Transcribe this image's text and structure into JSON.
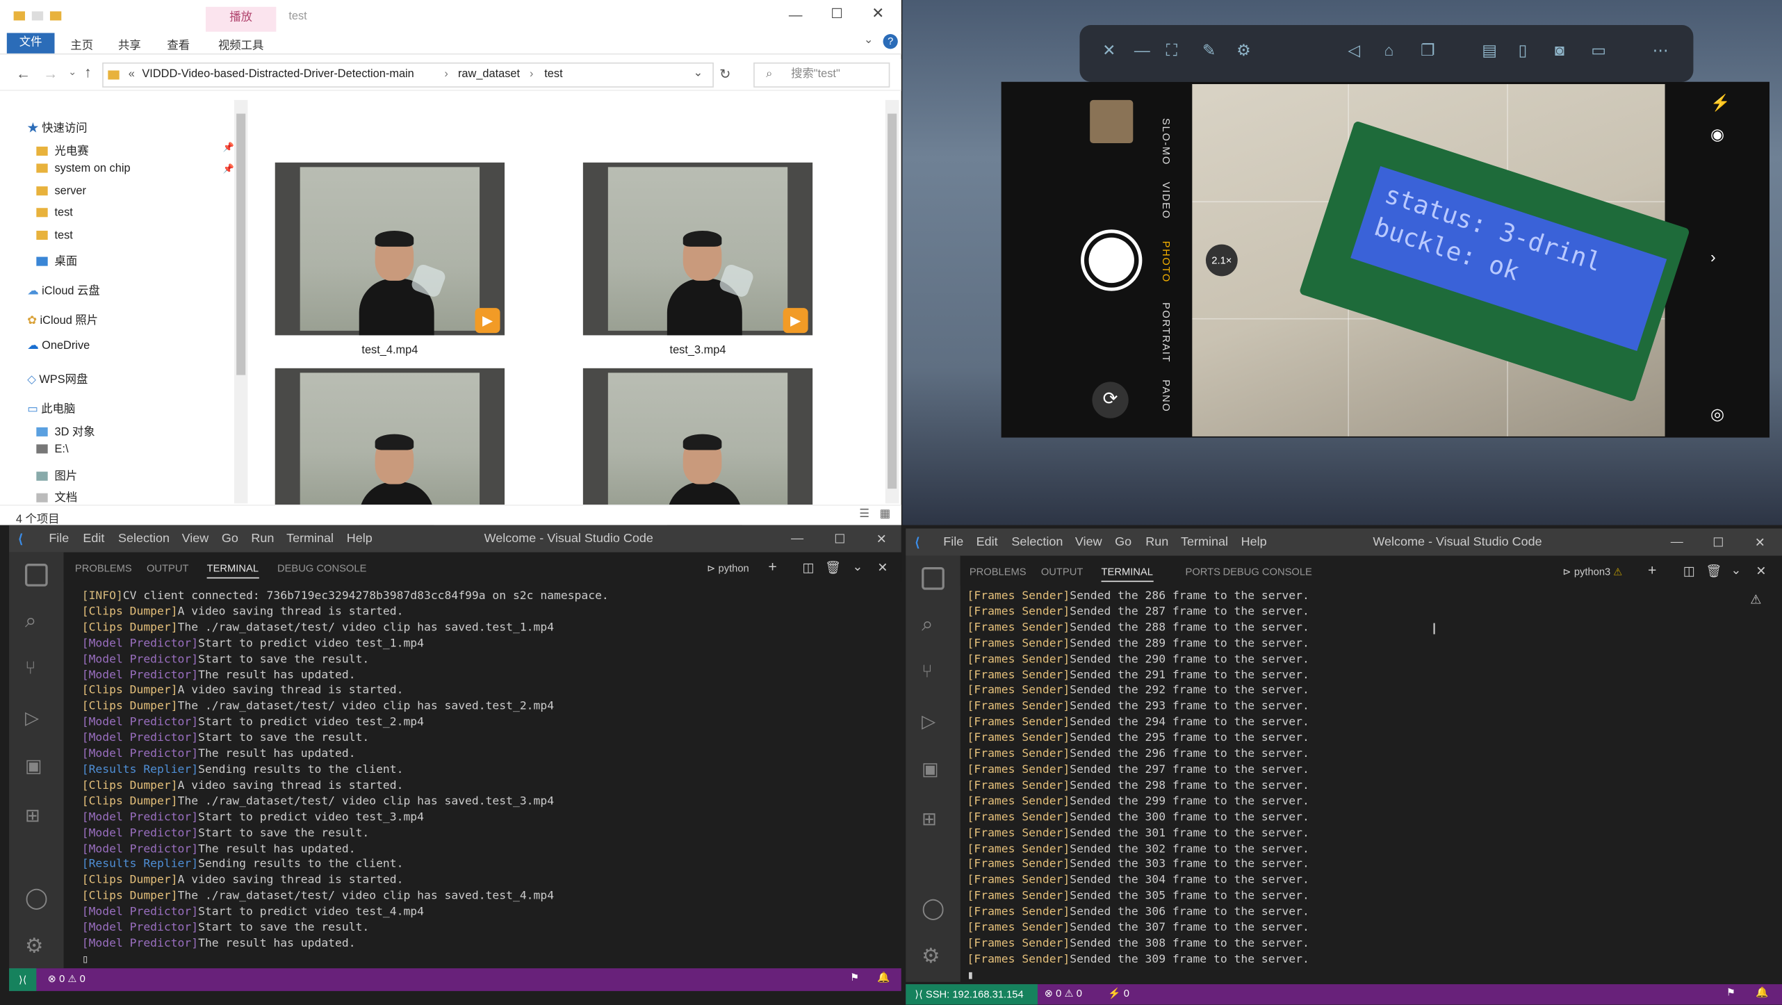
{
  "explorer": {
    "window_title": "test",
    "ribbon_context_tab": "播放",
    "ribbon_tabs": [
      "文件",
      "主页",
      "共享",
      "查看"
    ],
    "video_tools": "视频工具",
    "breadcrumb": [
      "«",
      "VIDDD-Video-based-Distracted-Driver-Detection-main",
      "raw_dataset",
      "test"
    ],
    "search_placeholder": "搜索\"test\"",
    "nav": [
      "快速访问",
      "光电赛",
      "system on chip",
      "server",
      "test",
      "test",
      "桌面",
      "iCloud 云盘",
      "iCloud 照片",
      "OneDrive",
      "WPS网盘",
      "此电脑",
      "3D 对象",
      "E:\\",
      "图片",
      "文档"
    ],
    "files": [
      "test_4.mp4",
      "test_3.mp4"
    ],
    "item_count": "4 个项目"
  },
  "camera": {
    "modes": [
      "SLO-MO",
      "VIDEO",
      "PHOTO",
      "PORTRAIT",
      "PANO"
    ],
    "zoom": "2.1×",
    "lcd_line1": "status: 3-drinl",
    "lcd_line2": "buckle: ok"
  },
  "vscode_left": {
    "title": "Welcome - Visual Studio Code",
    "menu": [
      "File",
      "Edit",
      "Selection",
      "View",
      "Go",
      "Run",
      "Terminal",
      "Help"
    ],
    "tabs": [
      "PROBLEMS",
      "OUTPUT",
      "TERMINAL",
      "DEBUG CONSOLE"
    ],
    "shell": "python",
    "lines": [
      [
        "[INFO]",
        "CV client connected: 736b719ec3294278b3987d83cc84f99a on s2c namespace."
      ],
      [
        "[Clips Dumper]",
        "A video saving thread is started."
      ],
      [
        "[Clips Dumper]",
        "The ./raw_dataset/test/ video clip has saved.test_1.mp4"
      ],
      [
        "[Model Predictor]",
        "Start to predict video test_1.mp4"
      ],
      [
        "[Model Predictor]",
        "Start to save the result."
      ],
      [
        "[Model Predictor]",
        "The result has updated."
      ],
      [
        "[Clips Dumper]",
        "A video saving thread is started."
      ],
      [
        "[Clips Dumper]",
        "The ./raw_dataset/test/ video clip has saved.test_2.mp4"
      ],
      [
        "[Model Predictor]",
        "Start to predict video test_2.mp4"
      ],
      [
        "[Model Predictor]",
        "Start to save the result."
      ],
      [
        "[Model Predictor]",
        "The result has updated."
      ],
      [
        "[Results Replier]",
        "Sending results to the client."
      ],
      [
        "[Clips Dumper]",
        "A video saving thread is started."
      ],
      [
        "[Clips Dumper]",
        "The ./raw_dataset/test/ video clip has saved.test_3.mp4"
      ],
      [
        "[Model Predictor]",
        "Start to predict video test_3.mp4"
      ],
      [
        "[Model Predictor]",
        "Start to save the result."
      ],
      [
        "[Model Predictor]",
        "The result has updated."
      ],
      [
        "[Results Replier]",
        "Sending results to the client."
      ],
      [
        "[Clips Dumper]",
        "A video saving thread is started."
      ],
      [
        "[Clips Dumper]",
        "The ./raw_dataset/test/ video clip has saved.test_4.mp4"
      ],
      [
        "[Model Predictor]",
        "Start to predict video test_4.mp4"
      ],
      [
        "[Model Predictor]",
        "Start to save the result."
      ],
      [
        "[Model Predictor]",
        "The result has updated."
      ]
    ],
    "status_problems": "⊗ 0 ⚠ 0"
  },
  "vscode_right": {
    "title": "Welcome - Visual Studio Code",
    "menu": [
      "File",
      "Edit",
      "Selection",
      "View",
      "Go",
      "Run",
      "Terminal",
      "Help"
    ],
    "tabs": [
      "PROBLEMS",
      "OUTPUT",
      "TERMINAL",
      "PORTS",
      "DEBUG CONSOLE"
    ],
    "shell": "python3",
    "frames": [
      286,
      287,
      288,
      289,
      290,
      291,
      292,
      293,
      294,
      295,
      296,
      297,
      298,
      299,
      300,
      301,
      302,
      303,
      304,
      305,
      306,
      307,
      308,
      309
    ],
    "frame_prefix": "[Frames Sender]",
    "frame_text": "Sended the {n} frame to the server.",
    "status_ssh": "SSH: 192.168.31.154",
    "status_problems": "⊗ 0 ⚠ 0",
    "status_ports": "⚡ 0"
  },
  "colors": {
    "statusbar": "#68217a",
    "explorer_tab": "#2b6cb8"
  }
}
